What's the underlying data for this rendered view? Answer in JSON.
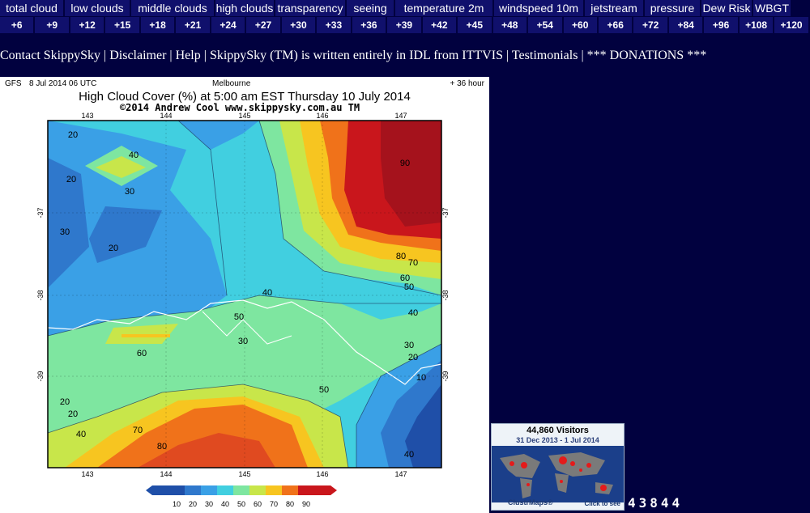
{
  "nav": {
    "row1": [
      "total cloud",
      "low clouds",
      "middle clouds",
      "high clouds",
      "transparency",
      "seeing",
      "temperature 2m",
      "windspeed 10m",
      "jetstream",
      "pressure",
      "Dew Risk",
      "WBGT"
    ],
    "row2": [
      "+6",
      "+9",
      "+12",
      "+15",
      "+18",
      "+21",
      "+24",
      "+27",
      "+30",
      "+33",
      "+36",
      "+39",
      "+42",
      "+45",
      "+48",
      "+54",
      "+60",
      "+66",
      "+72",
      "+84",
      "+96",
      "+108",
      "+120"
    ]
  },
  "links": [
    "Contact SkippySky",
    "Disclaimer",
    "Help",
    "SkippySky (TM) is written entirely in IDL from ITTVIS",
    "Testimonials",
    "*** DONATIONS ***"
  ],
  "map": {
    "model": "GFS",
    "run": "8 Jul 2014 06 UTC",
    "location": "Melbourne",
    "lead": "+ 36 hour",
    "title": "High Cloud Cover (%) at 5:00 am EST Thursday 10 July 2014",
    "credit": "©2014 Andrew Cool  www.skippysky.com.au  TM",
    "lon_ticks": [
      "143",
      "144",
      "145",
      "146",
      "147"
    ],
    "lat_ticks": [
      "-37",
      "-38",
      "-39"
    ],
    "legend_ticks": [
      "10",
      "20",
      "30",
      "40",
      "50",
      "60",
      "70",
      "80",
      "90"
    ],
    "contour_labels": [
      "20",
      "20",
      "40",
      "30",
      "30",
      "20",
      "90",
      "80",
      "70",
      "60",
      "50",
      "40",
      "30",
      "20",
      "10",
      "50",
      "60",
      "70",
      "80",
      "50",
      "40",
      "30",
      "20",
      "20",
      "40",
      "40"
    ],
    "colors": {
      "c10": "#1f4fa8",
      "c20": "#2f78cc",
      "c30": "#3aa0e6",
      "c40": "#41cfe0",
      "c50": "#7ee6a0",
      "c60": "#c8e64a",
      "c70": "#f7c520",
      "c80": "#f0721a",
      "c90": "#c9161c"
    }
  },
  "clustrmap": {
    "visitors": "44,860 Visitors",
    "range": "31 Dec 2013 - 1 Jul 2014",
    "brand": "ClustrMaps®",
    "cta": "Click to see"
  },
  "counter": "43844",
  "sep": "|"
}
